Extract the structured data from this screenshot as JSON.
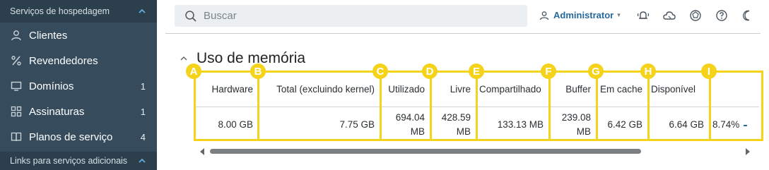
{
  "sidebar": {
    "section_top": "Serviços de hospedagem",
    "items": [
      {
        "label": "Clientes",
        "count": ""
      },
      {
        "label": "Revendedores",
        "count": ""
      },
      {
        "label": "Domínios",
        "count": "1"
      },
      {
        "label": "Assinaturas",
        "count": "1"
      },
      {
        "label": "Planos de serviço",
        "count": "4"
      }
    ],
    "section_bottom": "Links para serviços adicionais"
  },
  "topbar": {
    "search_placeholder": "Buscar",
    "user": "Administrator",
    "icons": [
      "notifications-icon",
      "cloud-icon",
      "extensions-icon",
      "help-icon",
      "moon-icon"
    ]
  },
  "panel": {
    "title": "Uso de memória",
    "headers": [
      "Hardware",
      "Total (excluindo kernel)",
      "Utilizado",
      "Livre",
      "Compartilhado",
      "Buffer",
      "Em cache",
      "Disponível",
      ""
    ],
    "row": [
      "8.00 GB",
      "7.75 GB",
      "694.04 MB",
      "428.59 MB",
      "133.13 MB",
      "239.08 MB",
      "6.42 GB",
      "6.64 GB",
      "8.74%"
    ],
    "badges": [
      "A",
      "B",
      "C",
      "D",
      "E",
      "F",
      "G",
      "H",
      "I"
    ]
  },
  "colors": {
    "sidebar_bg": "#364c5d",
    "highlight": "#f5d31a",
    "link": "#24689d"
  }
}
